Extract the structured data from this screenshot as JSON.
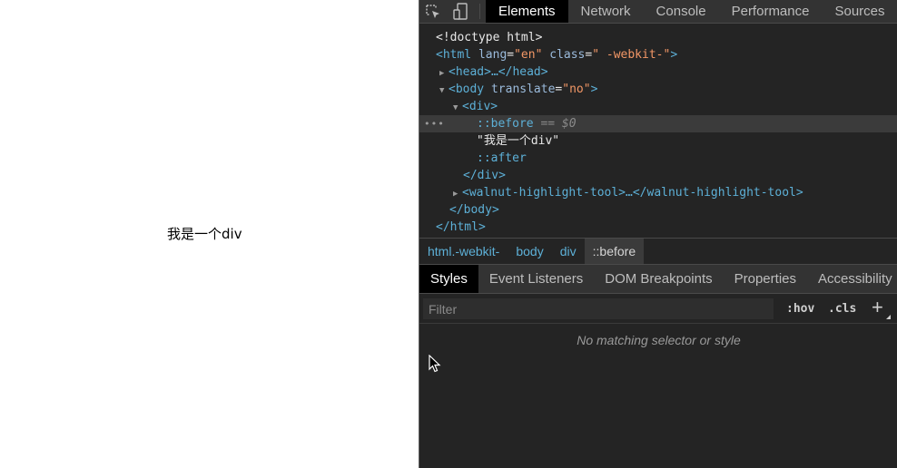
{
  "page": {
    "content_text": "我是一个div"
  },
  "devtools": {
    "tools": [
      {
        "icon": "inspect-element-icon"
      },
      {
        "icon": "device-toolbar-icon"
      }
    ],
    "tabs": [
      {
        "label": "Elements",
        "active": true
      },
      {
        "label": "Network"
      },
      {
        "label": "Console"
      },
      {
        "label": "Performance"
      },
      {
        "label": "Sources"
      }
    ],
    "dom": {
      "doctype": "<!doctype html>",
      "html_open": "<html",
      "html_attr_lang": "lang",
      "html_attr_lang_val": "\"en\"",
      "html_attr_class": "class",
      "html_attr_class_val": "\" -webkit-\"",
      "html_close_bracket": ">",
      "head": "<head>…</head>",
      "body_open": "<body",
      "body_attr": "translate",
      "body_attr_val": "\"no\"",
      "body_close_bracket": ">",
      "div_open": "<div>",
      "before": "::before",
      "before_eq": "== $0",
      "div_text": "\"我是一个div\"",
      "after": "::after",
      "div_close": "</div>",
      "walnut": "<walnut-highlight-tool>…</walnut-highlight-tool>",
      "body_close": "</body>",
      "html_close": "</html>",
      "dots": "•••"
    },
    "breadcrumbs": [
      "html.-webkit-",
      "body",
      "div",
      "::before"
    ],
    "subtabs": [
      {
        "label": "Styles",
        "active": true
      },
      {
        "label": "Event Listeners"
      },
      {
        "label": "DOM Breakpoints"
      },
      {
        "label": "Properties"
      },
      {
        "label": "Accessibility"
      }
    ],
    "filter": {
      "placeholder": "Filter",
      "value": "",
      "hov_label": ":hov",
      "cls_label": ".cls",
      "plus_label": "+"
    },
    "empty_message": "No matching selector or style"
  }
}
